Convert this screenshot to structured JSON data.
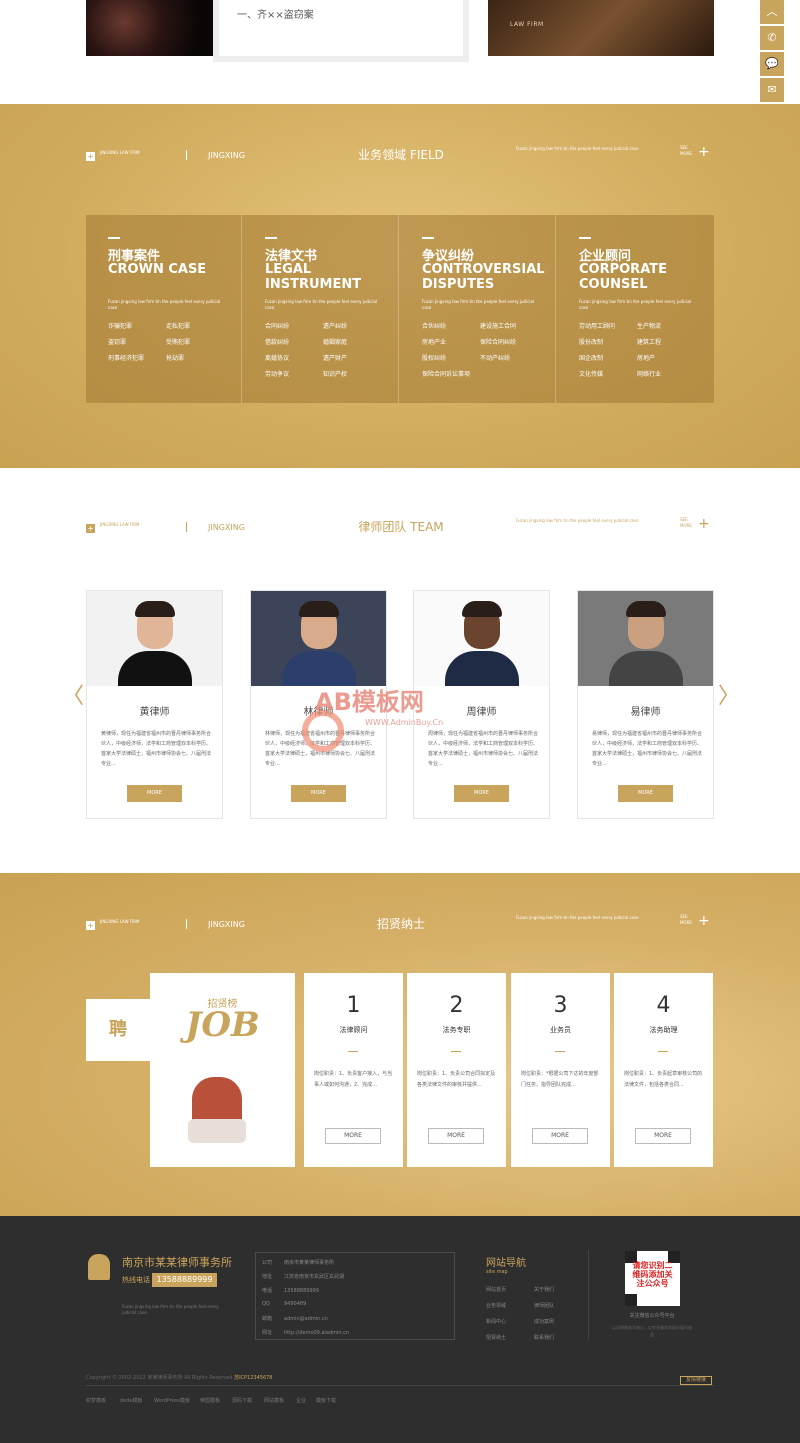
{
  "top": {
    "news_item": "一、齐××盗窃案",
    "law_firm_tag": "LAW FIRM"
  },
  "float": [
    "︿",
    "✆",
    "💬",
    "✉"
  ],
  "common": {
    "jingxing": "JINGXING",
    "tiny": "JINGXING LAW FIRM",
    "desc": "Fuzan jingxing law firm tin the people feel every judicial case",
    "more": "SEE MORE",
    "plus": "+"
  },
  "field": {
    "title": "业务领域 FIELD",
    "cards": [
      {
        "cn": "刑事案件",
        "en": "CROWN CASE",
        "desc": "Fuzan jingxing law firm tin the people feel every judicial case",
        "items": [
          "诈骗犯罪",
          "走私犯罪",
          "盗窃罪",
          "受贿犯罪",
          "刑事经济犯罪",
          "抢劫罪"
        ]
      },
      {
        "cn": "法律文书",
        "en": "LEGAL INSTRUMENT",
        "desc": "Fuzan jingxing law firm tin the people feel every judicial case",
        "items": [
          "合同纠纷",
          "遗产纠纷",
          "借款纠纷",
          "婚姻家庭",
          "离婚协议",
          "遗产财产",
          "劳动争议",
          "知识产权"
        ]
      },
      {
        "cn": "争议纠纷",
        "en": "CONTROVERSIAL DISPUTES",
        "desc": "Fuzan jingxing law firm tin the people feel every judicial case",
        "items": [
          "合伙纠纷",
          "建设施工合同",
          "房地产业",
          "保险合同纠纷",
          "股权纠纷",
          "不动产纠纷",
          "保险合同诉讼事项"
        ]
      },
      {
        "cn": "企业顾问",
        "en": "CORPORATE COUNSEL",
        "desc": "Fuzan jingxing law firm tin the people feel every judicial case",
        "items": [
          "劳动用工顾问",
          "生产物流",
          "股份改制",
          "建筑工程",
          "国企改制",
          "房地产",
          "文化传媒",
          "网络行业"
        ]
      }
    ]
  },
  "team": {
    "title": "律师团队 TEAM",
    "prev": "〈",
    "next": "〉",
    "watermark": "AB模板网",
    "watermark_url": "WWW.AdminBuy.Cn",
    "lawyers": [
      {
        "name": "黄律师",
        "bio": "黄律师，现任为福建省福州市的晋丹律师事务所合伙人，中级经济师，法学和工商管理双本科学历、首家大学法律硕士，福州市律师协会七、八届刑法专业...",
        "more": "MORE",
        "skin": "#e1b598",
        "suit": "#111111",
        "bg": "#f2f2f2"
      },
      {
        "name": "林律师",
        "bio": "林律师，现任为福建省福州市的晋丹律师事务所合伙人，中级经济师，法学和工商管理双本科学历、首家大学法律硕士，福州市律师协会七、八届刑法专业...",
        "more": "MORE",
        "skin": "#d8ab8a",
        "suit": "#2c3e6b",
        "bg": "#3b4458"
      },
      {
        "name": "周律师",
        "bio": "周律师，现任为福建省福州市的晋丹律师事务所合伙人，中级经济师，法学和工商管理双本科学历、首家大学法律硕士，福州市律师协会七、八届刑法专业...",
        "more": "MORE",
        "skin": "#6b4430",
        "suit": "#1f2a45",
        "bg": "#fafafa"
      },
      {
        "name": "易律师",
        "bio": "易律师，现任为福建省福州市的晋丹律师事务所合伙人，中级经济师，法学和工商管理双本科学历、首家大学法律硕士，福州市律师协会七、八届刑法专业...",
        "more": "MORE",
        "skin": "#caa080",
        "suit": "#444444",
        "bg": "#7a7a7a"
      }
    ]
  },
  "jobs": {
    "title": "招贤纳士",
    "pin": "聘",
    "big_cn": "招贤榜",
    "big_en": "JOB",
    "cards": [
      {
        "num": "1",
        "title": "法律顾问",
        "desc": "岗位职责：1、负责客户接入，与当事人或如何沟通；2、完成...",
        "more": "MORE"
      },
      {
        "num": "2",
        "title": "法务专职",
        "desc": "岗位职责：1、负责公司合同拟定及各类法律文件的审核并提供...",
        "more": "MORE"
      },
      {
        "num": "3",
        "title": "业务员",
        "desc": "岗位职责：*根据公司下达的年度部门任务，指导团队完成...",
        "more": "MORE"
      },
      {
        "num": "4",
        "title": "法务助理",
        "desc": "岗位职责：1、负责起草审核公司的法律文件，包括各类合同...",
        "more": "MORE"
      }
    ]
  },
  "footer": {
    "company": "南京市某某律师事务所",
    "tel_label": "热线电话",
    "tel": "13588889999",
    "desc": "Fuzan jingxing law firm tin the people feel every judicial case",
    "contact": [
      {
        "k": "公司",
        "v": "南京市某某律师事务所"
      },
      {
        "k": "地址",
        "v": "江苏省南京市玄武区玄武湖"
      },
      {
        "k": "电话",
        "v": "13588889999"
      },
      {
        "k": "QQ",
        "v": "9490489"
      },
      {
        "k": "邮箱",
        "v": "admin@admin.cn"
      },
      {
        "k": "网址",
        "v": "http://demo09.aiadmin.cn"
      }
    ],
    "nav_title": "网站导航",
    "nav_sub": "site map",
    "nav": [
      "网站首页",
      "关于我们",
      "业务领域",
      "律师团队",
      "新闻中心",
      "成功案例",
      "招贤纳士",
      "联系我们"
    ],
    "qr_text": "请您识别二维码添加关注公众号",
    "qr_caption": "关注微信公众号平台",
    "qr_note": "以法律服务为核心，以专业服务体现价值与效益",
    "copyright": "Copyright © 2002-2022 某某律师事务所 All Rights Reserved",
    "icp": "苏ICP12345678",
    "tag": "友情链接",
    "links": [
      "织梦模板",
      "dede模板",
      "WordPress模板",
      "帝国模板",
      "源码下载",
      "网站模板",
      "企业",
      "模板下载"
    ]
  }
}
